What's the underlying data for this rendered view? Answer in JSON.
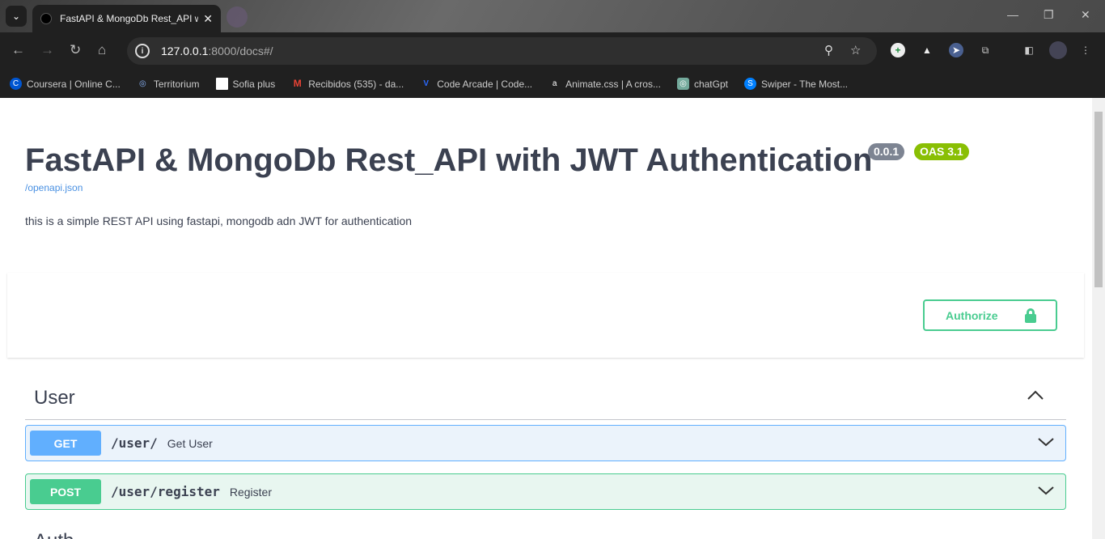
{
  "browser": {
    "tab_title": "FastAPI & MongoDb Rest_API w",
    "url_host": "127.0.0.1",
    "url_rest": ":8000/docs#/",
    "bookmarks": [
      {
        "label": "Coursera | Online C...",
        "color": "#0056d2",
        "glyph": "C"
      },
      {
        "label": "Territorium",
        "color": "#203a6a",
        "glyph": "◎"
      },
      {
        "label": "Sofia plus",
        "color": "#ffffff",
        "glyph": ""
      },
      {
        "label": "Recibidos (535) - da...",
        "color": "#ea4335",
        "glyph": "M"
      },
      {
        "label": "Code Arcade | Code...",
        "color": "#2a5adf",
        "glyph": "V"
      },
      {
        "label": "Animate.css | A cros...",
        "color": "#000000",
        "glyph": "a"
      },
      {
        "label": "chatGpt",
        "color": "#74aa9c",
        "glyph": "◎"
      },
      {
        "label": "Swiper - The Most...",
        "color": "#0080ff",
        "glyph": "S"
      }
    ]
  },
  "api": {
    "title": "FastAPI & MongoDb Rest_API with JWT Authentication",
    "version": "0.0.1",
    "oas": "OAS 3.1",
    "openapi_link": "/openapi.json",
    "description": "this is a simple REST API using fastapi, mongodb adn JWT for authentication",
    "authorize_label": "Authorize"
  },
  "sections": [
    {
      "name": "User",
      "operations": [
        {
          "method": "GET",
          "path": "/user/",
          "summary": "Get User"
        },
        {
          "method": "POST",
          "path": "/user/register",
          "summary": "Register"
        }
      ]
    },
    {
      "name": "Auth"
    }
  ],
  "colors": {
    "get": "#61affe",
    "post": "#49cc90",
    "get_bg": "#ebf3fb",
    "post_bg": "#e8f6f0",
    "version_badge": "#7d8492",
    "oas_badge": "#89bf04"
  }
}
